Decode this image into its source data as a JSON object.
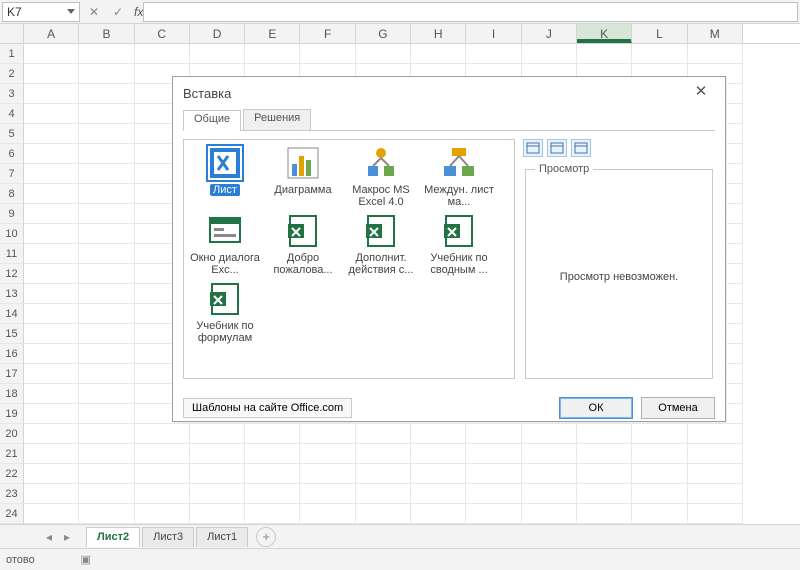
{
  "namebox": {
    "value": "K7"
  },
  "formula_bar": {
    "fx_label": "fx",
    "cancel_glyph": "✕",
    "accept_glyph": "✓"
  },
  "columns": [
    "A",
    "B",
    "C",
    "D",
    "E",
    "F",
    "G",
    "H",
    "I",
    "J",
    "K",
    "L",
    "M"
  ],
  "selected_column_index": 10,
  "row_count": 24,
  "active_cell": {
    "col_index": 10,
    "row_index": 6
  },
  "sheet_tabs": {
    "items": [
      {
        "label": "Лист2",
        "active": true
      },
      {
        "label": "Лист3",
        "active": false
      },
      {
        "label": "Лист1",
        "active": false
      }
    ],
    "add_glyph": "+"
  },
  "statusbar": {
    "text": "отово"
  },
  "dialog": {
    "title": "Вставка",
    "close_glyph": "✕",
    "tabs": [
      {
        "label": "Общие",
        "active": true
      },
      {
        "label": "Решения",
        "active": false
      }
    ],
    "templates": [
      {
        "name": "sheet",
        "label": "Лист",
        "selected": true,
        "icon": "xl-sheet"
      },
      {
        "name": "chart",
        "label": "Диаграмма",
        "selected": false,
        "icon": "chart"
      },
      {
        "name": "macro40",
        "label": "Макрос MS Excel 4.0",
        "selected": false,
        "icon": "flow1"
      },
      {
        "name": "intl-macro",
        "label": "Междун. лист ма...",
        "selected": false,
        "icon": "flow2"
      },
      {
        "name": "dialog-window",
        "label": "Окно диалога Exc...",
        "selected": false,
        "icon": "dialog"
      },
      {
        "name": "welcome",
        "label": "Добро пожалова...",
        "selected": false,
        "icon": "xlsx"
      },
      {
        "name": "addl-actions",
        "label": "Дополнит. действия с...",
        "selected": false,
        "icon": "xlsx"
      },
      {
        "name": "pivot-tutorial",
        "label": "Учебник по сводным ...",
        "selected": false,
        "icon": "xlsx"
      },
      {
        "name": "formula-tutorial",
        "label": "Учебник по формулам",
        "selected": false,
        "icon": "xlsx"
      }
    ],
    "view_buttons": [
      {
        "name": "large-icons"
      },
      {
        "name": "list-view"
      },
      {
        "name": "details-view"
      }
    ],
    "preview": {
      "legend": "Просмотр",
      "message": "Просмотр невозможен."
    },
    "footer": {
      "office_link": "Шаблоны на сайте Office.com",
      "ok": "ОК",
      "cancel": "Отмена"
    }
  }
}
